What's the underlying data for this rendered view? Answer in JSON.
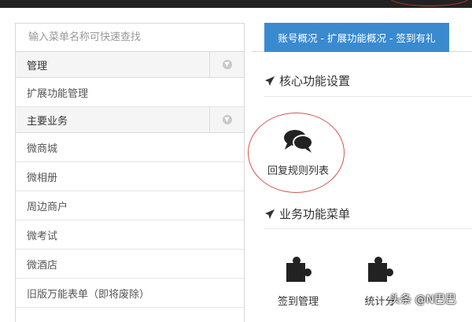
{
  "sidebar": {
    "search_placeholder": "输入菜单名称可快速查找",
    "group1": "管理",
    "item_ext": "扩展功能管理",
    "group2": "主要业务",
    "items": [
      "微商城",
      "微相册",
      "周边商户",
      "微考试",
      "微酒店",
      "旧版万能表单（即将废除）"
    ]
  },
  "breadcrumb": "账号概况 - 扩展功能概况 - 签到有礼",
  "sections": {
    "core": "核心功能设置",
    "business": "业务功能菜单"
  },
  "tiles": {
    "reply_rules": "回复规则列表",
    "checkin": "签到管理",
    "stats": "统计分"
  },
  "watermark": "头条 @N巴巴",
  "colors": {
    "accent": "#3a8ad0",
    "annotation": "#d9534f"
  }
}
